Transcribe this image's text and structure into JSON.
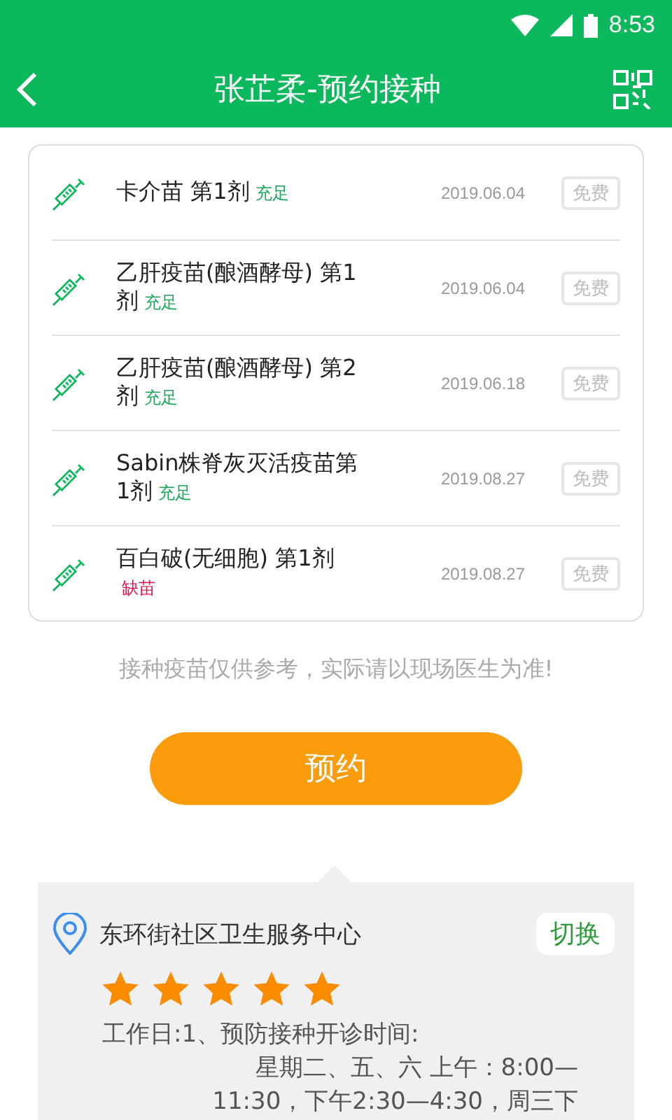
{
  "status_bar": {
    "time": "8:53"
  },
  "header": {
    "title": "张芷柔-预约接种"
  },
  "vaccines": [
    {
      "name": "卡介苗 第1剂",
      "stock": {
        "kind": "sufficient",
        "label": "充足"
      },
      "date": "2019.06.04",
      "price": "免费"
    },
    {
      "name": "乙肝疫苗(酿酒酵母) 第1剂",
      "stock": {
        "kind": "sufficient",
        "label": "充足"
      },
      "date": "2019.06.04",
      "price": "免费"
    },
    {
      "name": "乙肝疫苗(酿酒酵母) 第2剂",
      "stock": {
        "kind": "sufficient",
        "label": "充足"
      },
      "date": "2019.06.18",
      "price": "免费"
    },
    {
      "name": "Sabin株脊灰灭活疫苗第1剂",
      "stock": {
        "kind": "sufficient",
        "label": "充足"
      },
      "date": "2019.08.27",
      "price": "免费"
    },
    {
      "name": "百白破(无细胞) 第1剂",
      "stock": {
        "kind": "shortage",
        "label": "缺苗"
      },
      "date": "2019.08.27",
      "price": "免费"
    }
  ],
  "note": "接种疫苗仅供参考，实际请以现场医生为准!",
  "book_button": "预约",
  "clinic": {
    "name": "东环街社区卫生服务中心",
    "switch_button": "切换",
    "stars": 5,
    "hours": [
      {
        "kind": "heading",
        "text": "工作日:1、预防接种开诊时间:"
      },
      {
        "kind": "continued",
        "text": "星期二、五、六 上午：8:00—"
      },
      {
        "kind": "continued",
        "text": "11:30，下午2:30—4:30，周三下"
      }
    ]
  }
}
